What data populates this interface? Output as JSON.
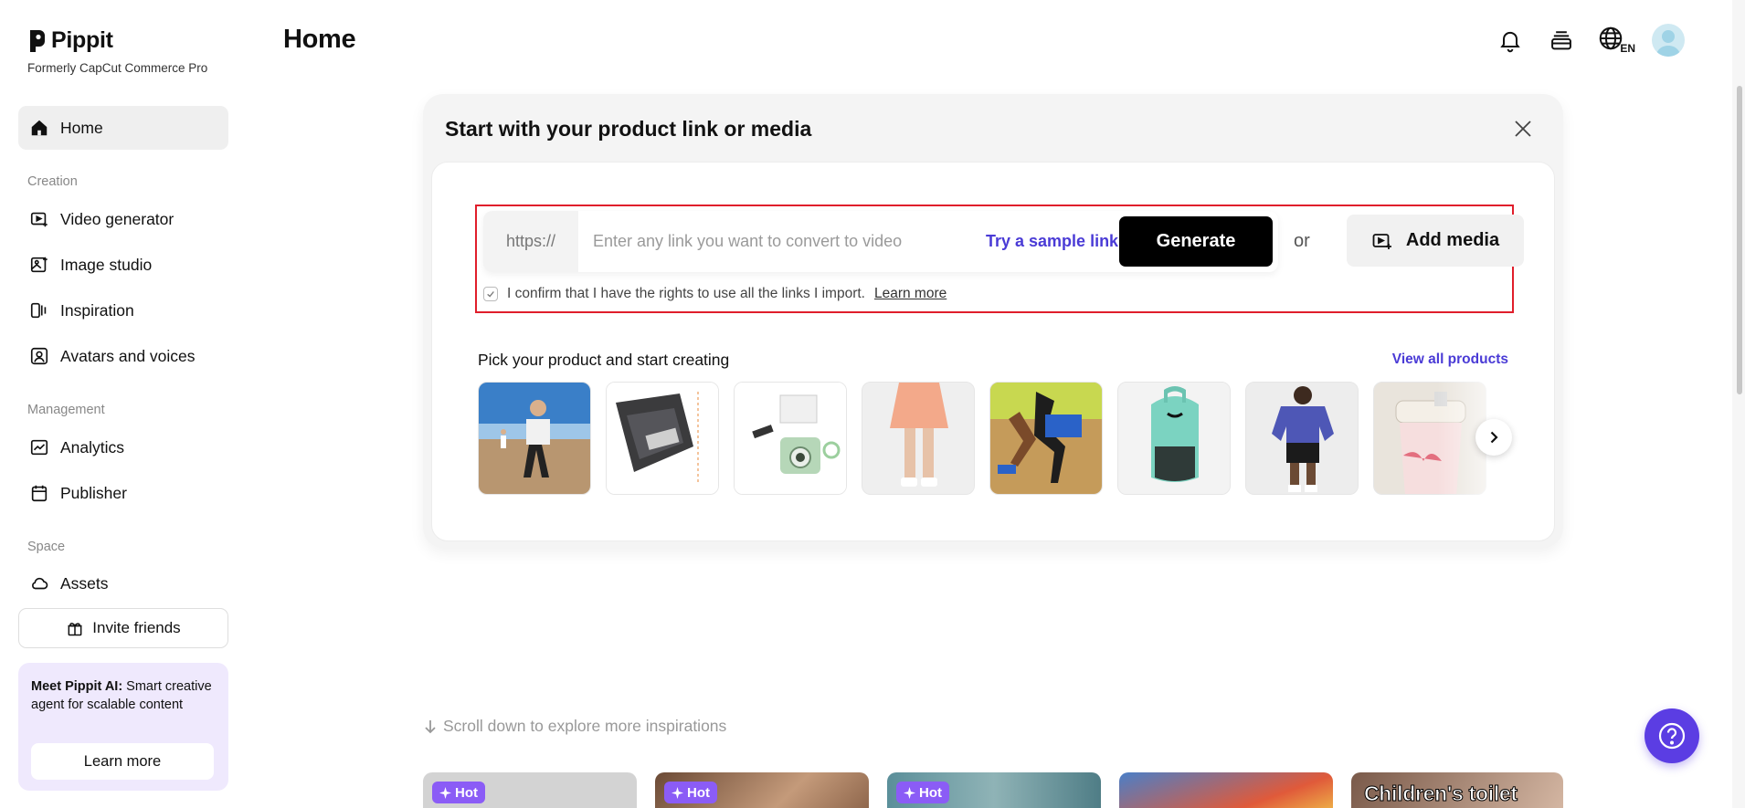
{
  "brand": {
    "name": "Pippit",
    "subtitle": "Formerly CapCut Commerce Pro"
  },
  "sidebar": {
    "home": "Home",
    "sections": [
      {
        "label": "Creation",
        "items": [
          "Video generator",
          "Image studio",
          "Inspiration",
          "Avatars and voices"
        ]
      },
      {
        "label": "Management",
        "items": [
          "Analytics",
          "Publisher"
        ]
      },
      {
        "label": "Space",
        "items": [
          "Assets"
        ]
      }
    ],
    "invite": "Invite friends",
    "promo": {
      "title": "Meet Pippit AI:",
      "text": " Smart creative agent for scalable content",
      "button": "Learn more"
    }
  },
  "header": {
    "title": "Home",
    "language": "EN"
  },
  "card": {
    "title": "Start with your product link or media",
    "prefix": "https://",
    "placeholder": "Enter any link you want to convert to video",
    "sample_link": "Try a sample link",
    "generate": "Generate",
    "or": "or",
    "add_media": "Add media",
    "confirm_text": "I confirm that I have the rights to use all the links I import.",
    "learn_more": "Learn more",
    "pick_title": "Pick your product and start creating",
    "view_all": "View all products"
  },
  "scroll_hint": "Scroll down to explore more inspirations",
  "inspirations": {
    "hot_label": "Hot",
    "last_caption": "Children's toilet"
  },
  "colors": {
    "accent": "#4a3bd6",
    "highlight": "#e01e2b",
    "help": "#5b3de3",
    "promo_bg": "#efe9fd"
  }
}
